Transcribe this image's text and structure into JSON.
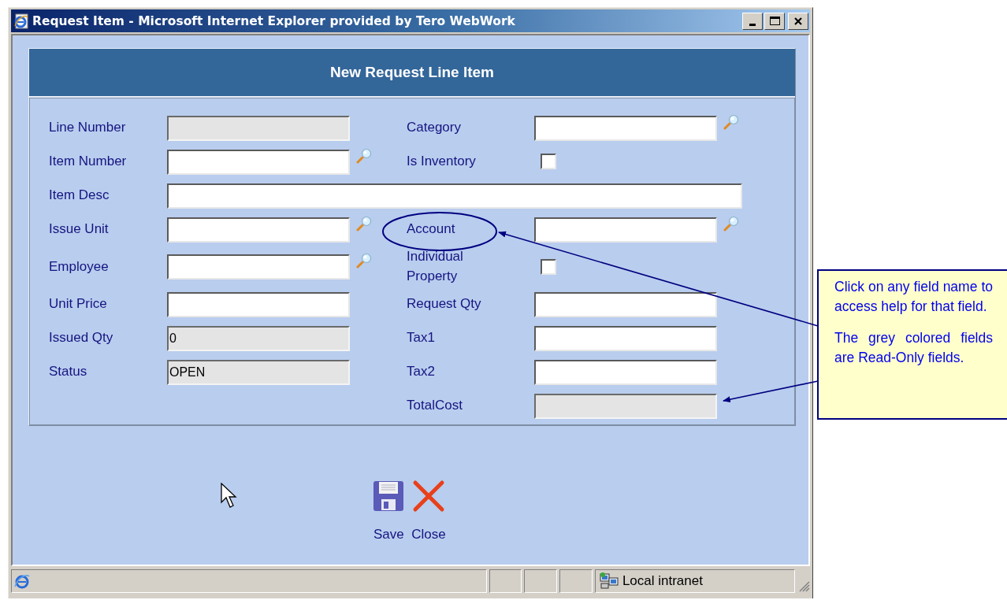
{
  "window": {
    "title": "Request Item - Microsoft Internet Explorer provided by Tero WebWork"
  },
  "form": {
    "title": "New Request Line Item",
    "rows": [
      {
        "left": {
          "label": "Line Number",
          "kind": "text",
          "readonly": true,
          "lookup": false
        },
        "right": {
          "label": "Category",
          "kind": "text",
          "readonly": false,
          "lookup": true
        }
      },
      {
        "left": {
          "label": "Item Number",
          "kind": "text",
          "readonly": false,
          "lookup": true
        },
        "right": {
          "label": "Is Inventory",
          "kind": "checkbox",
          "checked": false
        }
      },
      {
        "left": {
          "label": "Item Desc",
          "kind": "wide",
          "readonly": false,
          "lookup": false
        }
      },
      {
        "left": {
          "label": "Issue Unit",
          "kind": "text",
          "readonly": false,
          "lookup": true
        },
        "right": {
          "label": "Account",
          "kind": "text",
          "readonly": false,
          "lookup": true
        }
      },
      {
        "left": {
          "label": "Employee",
          "kind": "text",
          "readonly": false,
          "lookup": true
        },
        "right": {
          "label": "Individual Property",
          "kind": "checkbox",
          "checked": false
        }
      },
      {
        "left": {
          "label": "Unit Price",
          "kind": "text",
          "readonly": false,
          "lookup": false
        },
        "right": {
          "label": "Request Qty",
          "kind": "text",
          "readonly": false,
          "lookup": false
        }
      },
      {
        "left": {
          "label": "Issued Qty",
          "kind": "text",
          "readonly": true,
          "lookup": false,
          "value": "0"
        },
        "right": {
          "label": "Tax1",
          "kind": "text",
          "readonly": false,
          "lookup": false
        }
      },
      {
        "left": {
          "label": "Status",
          "kind": "text",
          "readonly": true,
          "lookup": false,
          "value": "OPEN"
        },
        "right": {
          "label": "Tax2",
          "kind": "text",
          "readonly": false,
          "lookup": false
        }
      },
      {
        "right": {
          "label": "TotalCost",
          "kind": "text",
          "readonly": true,
          "lookup": false
        }
      }
    ]
  },
  "buttons": [
    {
      "label": "Save",
      "kind": "save"
    },
    {
      "label": "Close",
      "kind": "close"
    }
  ],
  "callout": {
    "paragraphs": [
      "Click on any field name to access help for that field.",
      "The grey colored fields are Read-Only fields."
    ]
  },
  "status_bar": {
    "zone": "Local intranet"
  }
}
